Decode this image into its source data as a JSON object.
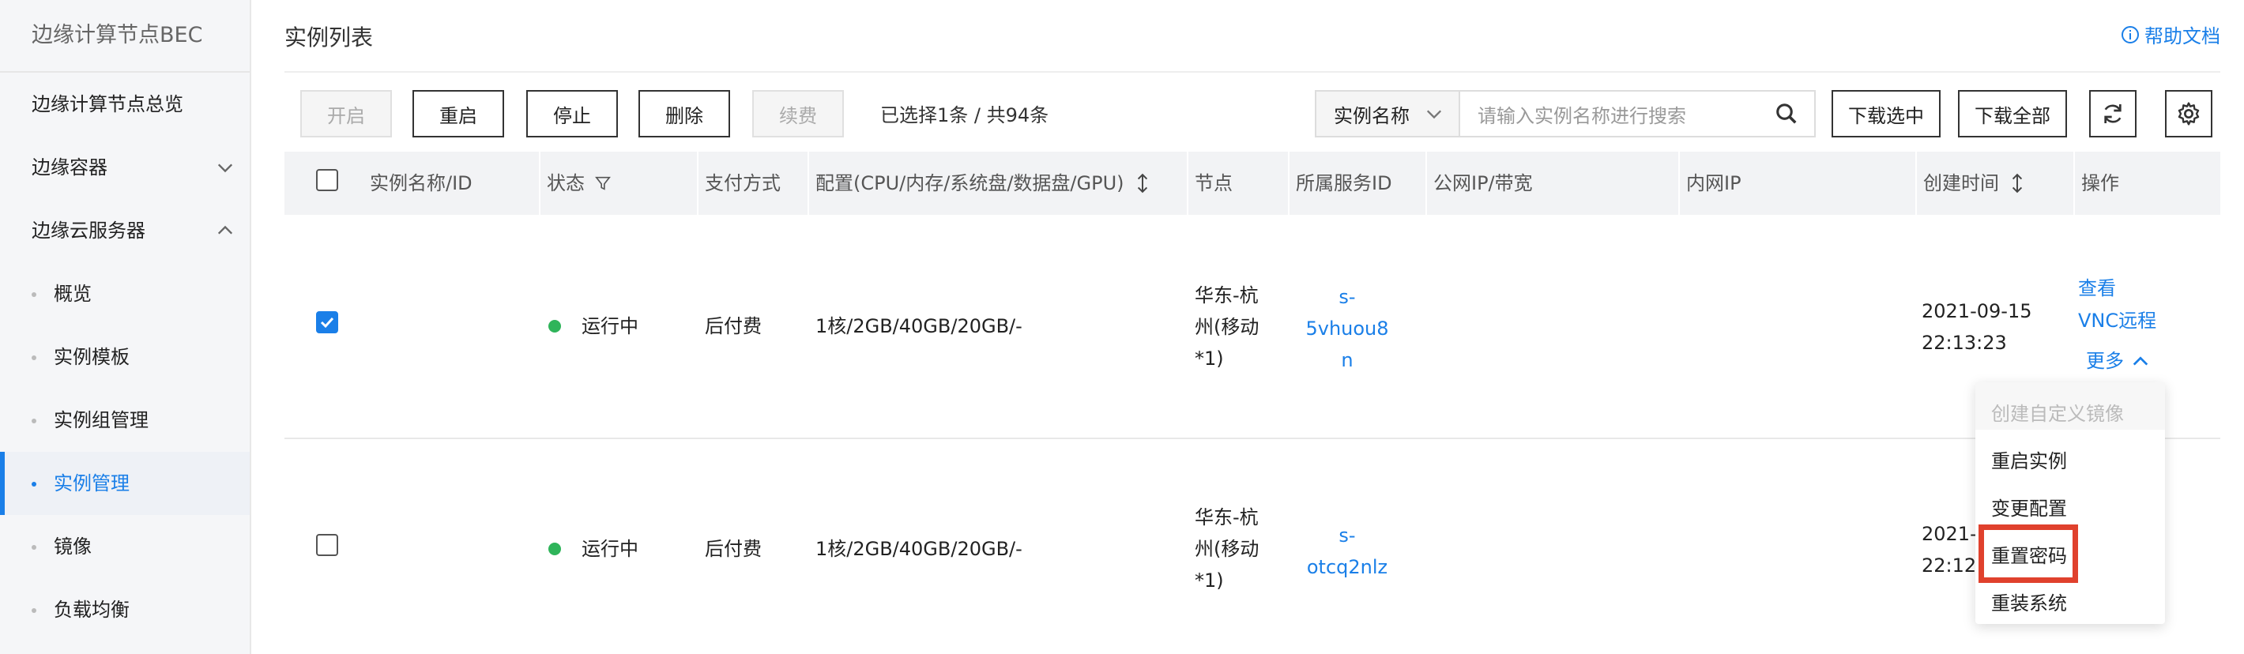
{
  "sidebar": {
    "title": "边缘计算节点BEC",
    "items": [
      {
        "label": "边缘计算节点总览"
      },
      {
        "label": "边缘容器"
      },
      {
        "label": "边缘云服务器"
      }
    ],
    "sub_items": [
      {
        "label": "概览"
      },
      {
        "label": "实例模板"
      },
      {
        "label": "实例组管理"
      },
      {
        "label": "实例管理"
      },
      {
        "label": "镜像"
      },
      {
        "label": "负载均衡"
      }
    ]
  },
  "header": {
    "title": "实例列表",
    "help": "帮助文档"
  },
  "toolbar": {
    "start": "开启",
    "restart": "重启",
    "stop": "停止",
    "delete": "删除",
    "renew": "续费",
    "selection_info": "已选择1条 / 共94条",
    "search_field": "实例名称",
    "search_placeholder": "请输入实例名称进行搜索",
    "download_selected": "下载选中",
    "download_all": "下载全部"
  },
  "table": {
    "columns": [
      "实例名称/ID",
      "状态",
      "支付方式",
      "配置(CPU/内存/系统盘/数据盘/GPU)",
      "节点",
      "所属服务ID",
      "公网IP/带宽",
      "内网IP",
      "创建时间",
      "操作"
    ],
    "rows": [
      {
        "checked": true,
        "status": "运行中",
        "payment": "后付费",
        "config": "1核/2GB/40GB/20GB/-",
        "node_lines": [
          "华东-杭",
          "州(移动",
          "*1)"
        ],
        "service_id_lines": [
          "s-",
          "5vhuou8",
          "n"
        ],
        "created_lines": [
          "2021-09-15",
          "22:13:23"
        ],
        "actions": {
          "view": "查看",
          "vnc": "VNC远程",
          "more": "更多"
        }
      },
      {
        "checked": false,
        "status": "运行中",
        "payment": "后付费",
        "config": "1核/2GB/40GB/20GB/-",
        "node_lines": [
          "华东-杭",
          "州(移动",
          "*1)"
        ],
        "service_id_lines": [
          "s-",
          "otcq2nlz"
        ],
        "created_lines": [
          "2021-0",
          "22:12:"
        ]
      }
    ]
  },
  "more_menu": {
    "items": [
      {
        "label": "创建自定义镜像",
        "disabled": true
      },
      {
        "label": "重启实例",
        "disabled": false
      },
      {
        "label": "变更配置",
        "disabled": false
      },
      {
        "label": "重置密码",
        "disabled": false
      },
      {
        "label": "重装系统",
        "disabled": false
      }
    ]
  },
  "colors": {
    "accent": "#1a7fe8",
    "status_running": "#2fb45a",
    "highlight": "#e0412d"
  }
}
